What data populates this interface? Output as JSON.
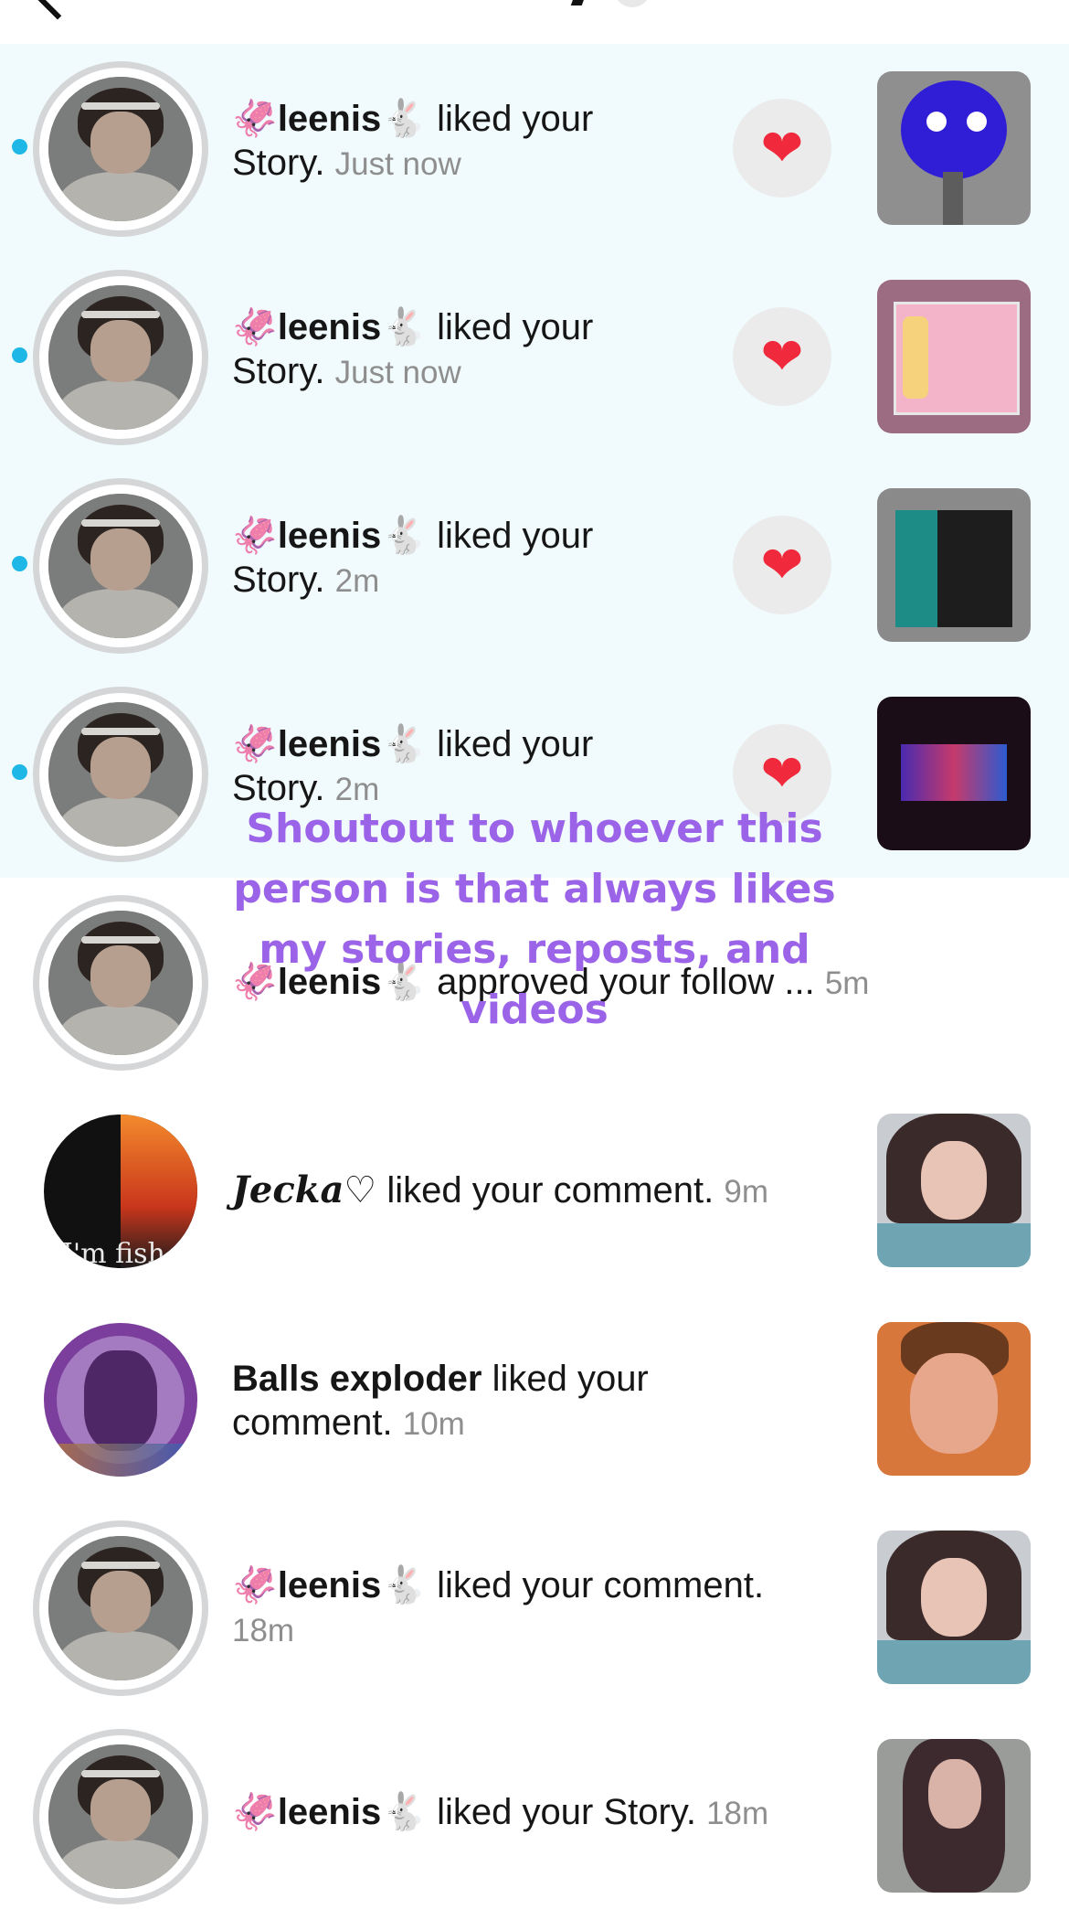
{
  "notifications": [
    {
      "user": "leenis",
      "emoji_before": "🦑",
      "emoji_after": "🐇",
      "action": "liked your",
      "action2": "Story.",
      "time": "Just now",
      "unread": true,
      "heart": true
    },
    {
      "user": "leenis",
      "emoji_before": "🦑",
      "emoji_after": "🐇",
      "action": "liked your",
      "action2": "Story.",
      "time": "Just now",
      "unread": true,
      "heart": true
    },
    {
      "user": "leenis",
      "emoji_before": "🦑",
      "emoji_after": "🐇",
      "action": "liked your",
      "action2": "Story.",
      "time": "2m",
      "unread": true,
      "heart": true
    },
    {
      "user": "leenis",
      "emoji_before": "🦑",
      "emoji_after": "🐇",
      "action": "liked your",
      "action2": "Story.",
      "time": "2m",
      "unread": true,
      "heart": true
    },
    {
      "user": "leenis",
      "emoji_before": "🦑",
      "emoji_after": "🐇",
      "action": "approved your follow ...",
      "time": "5m",
      "unread": false
    },
    {
      "user": "Jecka♡",
      "action": "liked your comment.",
      "time": "9m",
      "unread": false
    },
    {
      "user": "Balls exploder",
      "action": "liked your",
      "action2": "comment.",
      "time": "10m",
      "unread": false
    },
    {
      "user": "leenis",
      "emoji_before": "🦑",
      "emoji_after": "🐇",
      "action": "liked your comment.",
      "time": "18m",
      "unread": false
    },
    {
      "user": "leenis",
      "emoji_before": "🦑",
      "emoji_after": "🐇",
      "action": "liked your Story.",
      "time": "18m",
      "unread": false
    }
  ],
  "heart_glyph": "❤",
  "overlay_caption": "Shoutout to whoever this person is that always likes my stories, reposts, and videos",
  "avatar_text_fish": "I'm fish",
  "colors": {
    "unread_bg": "#f1fbfd",
    "unread_dot": "#1fb8e6",
    "heart": "#f02a3c",
    "overlay": "#9b64e8",
    "time": "#8e8e8e"
  },
  "icons": {
    "back": "chevron-left-icon",
    "heart": "heart-icon"
  }
}
